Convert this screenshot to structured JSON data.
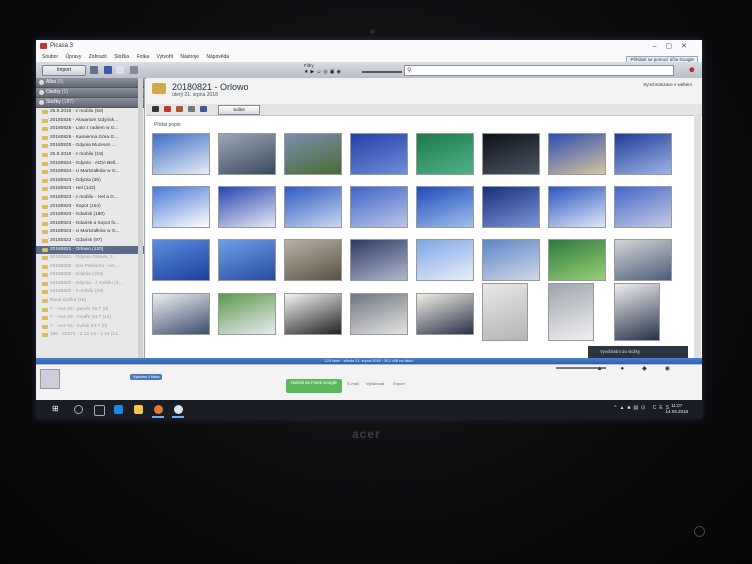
{
  "window": {
    "title": "Picasa 3"
  },
  "menu": [
    "Soubor",
    "Úpravy",
    "Zobrazit",
    "Složka",
    "Fotka",
    "Vytvořit",
    "Nástroje",
    "Nápověda"
  ],
  "signin_label": "Přihlásit se pomocí účtu Google",
  "toolbar": {
    "import_label": "Import",
    "filter_label": "Filtry",
    "search_placeholder": ""
  },
  "sidebar": {
    "sections": [
      {
        "label": "Alba",
        "count": "(5)"
      },
      {
        "label": "Osoby",
        "count": "(1)"
      },
      {
        "label": "Složky",
        "count": "(187)"
      }
    ],
    "folders": [
      "26.8.2018 - z mobilu (58)",
      "20180825 - Akwarium Gdyńsk...",
      "20180825 - Lato z radiem w G...",
      "20180825 - Kamienna Góra G...",
      "20180825 - Gdynia Muzeum ...",
      "25.8.2018 - z mobilu (19)",
      "20180824 - Gdynia - AIDA Bell...",
      "20180824 - U Marszałków w G...",
      "20180823 - Gdynia (36)",
      "20180823 - Hel (142)",
      "20180823 - z mobilu - Hel a G...",
      "20180823 - Sopot (154)",
      "20180823 - Gdańsk (180)",
      "20180823 - Gdańsk a Sopot fo...",
      "20180823 - U Marszałków w G...",
      "20180823 - Gdańsk (97)",
      "20180821 - Orlowo (120)",
      "20180821 - Gdynia Orłowo, z...",
      "20180820 - Dar Pomorza - mn...",
      "20180820 - Gdynia (154)",
      "20180820 - Gdynia - z mobilu (3...",
      "20180820 - z mobilu (28)",
      "Nová složka (19)",
      "7. - ece 53 - poměr 16:7 (0)",
      "7. - ece 53 - modře 24:7 (12)",
      "7. - ece 53 - světle 24:7 (0)",
      "180 - 20171 - 2.12.14 - 1.14 (14..."
    ],
    "selected_index": 16
  },
  "album": {
    "title": "20180821 - Orlowo",
    "date": "úterý 21. srpna 2018",
    "sync_label": "Synchronizace s webem",
    "caption_placeholder": "Přidat popis",
    "share_label": "Sdílet"
  },
  "thumbnails": [
    [
      "#3d6fc4",
      "#e8eef8"
    ],
    [
      "#9aa7b6",
      "#3b4a5e"
    ],
    [
      "#7a8fb1",
      "#4a6b33"
    ],
    [
      "#2440a8",
      "#6f8ed8"
    ],
    [
      "#1e7a4a",
      "#4fb38a"
    ],
    [
      "#0e1218",
      "#4a5563"
    ],
    [
      "#2b4fb0",
      "#d6c3a0"
    ],
    [
      "#1f3d95",
      "#9db4e8"
    ],
    [
      "#4a79d6",
      "#ffffff"
    ],
    [
      "#2646b0",
      "#e6e9f4"
    ],
    [
      "#2e5ac4",
      "#c8d8ef"
    ],
    [
      "#3f64c9",
      "#b9c7e8"
    ],
    [
      "#1f4bb8",
      "#9fc0f0"
    ],
    [
      "#182e7a",
      "#7b96d8"
    ],
    [
      "#2b56c0",
      "#dfe8f8"
    ],
    [
      "#4466c8",
      "#c5cde2"
    ],
    [
      "#5a8ee0",
      "#1f3f9a"
    ],
    [
      "#6ea0ea",
      "#284a9e"
    ],
    [
      "#b9b2a4",
      "#5a5344"
    ],
    [
      "#2d3a66",
      "#b0b9cc"
    ],
    [
      "#7da6e8",
      "#e9eef8"
    ],
    [
      "#5b86c8",
      "#d2d8e6"
    ],
    [
      "#2c7a3c",
      "#9bcf78"
    ],
    [
      "#d6d6d6",
      "#4a5c7a"
    ],
    [
      "#eef0f4",
      "#3c4c6c"
    ],
    [
      "#5c9a4a",
      "#e8ecf3"
    ],
    [
      "#f4f4f4",
      "#222222"
    ],
    [
      "#6f7682",
      "#e4e4e2"
    ],
    [
      "#f2efe7",
      "#2a3148"
    ],
    [
      "#e8e8e8",
      "#b4b4b4"
    ],
    [
      "#9ea4ae",
      "#f0f0f0"
    ],
    [
      "#efefef",
      "#27314a"
    ]
  ],
  "status": {
    "text": "120 fotek · středa 21. srpna 2018 · 30,2 MB na disku"
  },
  "bottom": {
    "upload_label": "Nahrát do Fotek Google",
    "actions": [
      "E-mail",
      "Vytisknout",
      "Export"
    ],
    "tooltip": "Vybráno 1 fotka",
    "email_panel": "Vyvolávání do složky"
  },
  "taskbar": {
    "tray_lang": "CES",
    "time": "11:07",
    "date": "14.09.2018"
  },
  "laptop_brand": "acer"
}
